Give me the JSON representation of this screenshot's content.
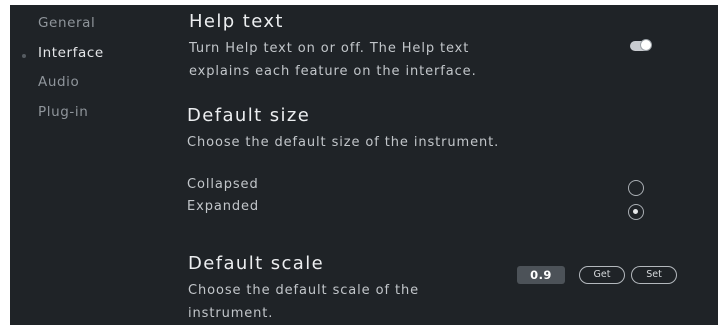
{
  "sidebar": {
    "items": [
      {
        "label": "General"
      },
      {
        "label": "Interface"
      },
      {
        "label": "Audio"
      },
      {
        "label": "Plug-in"
      }
    ]
  },
  "help": {
    "title": "Help text",
    "desc_line1": "Turn Help text on or off. The Help text",
    "desc_line2": "explains each feature on the interface.",
    "toggle_on": true
  },
  "size": {
    "title": "Default size",
    "desc": "Choose the default size of the instrument.",
    "options": [
      {
        "label": "Collapsed",
        "selected": false
      },
      {
        "label": "Expanded",
        "selected": true
      }
    ]
  },
  "scale": {
    "title": "Default scale",
    "desc_line1": "Choose the default scale of the",
    "desc_line2": "instrument.",
    "value": "0.9",
    "get_label": "Get",
    "set_label": "Set"
  },
  "colors": {
    "background": "#1f2327",
    "text": "#d7dadd",
    "muted": "#8f959b"
  }
}
